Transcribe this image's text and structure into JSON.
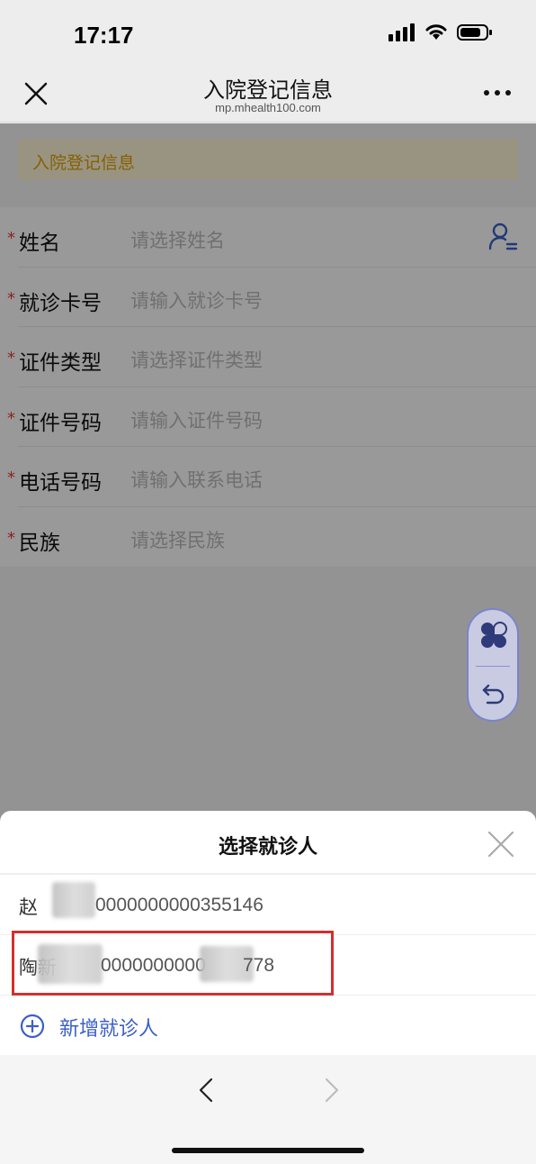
{
  "status_bar": {
    "time": "17:17"
  },
  "nav": {
    "title": "入院登记信息",
    "subtitle": "mp.mhealth100.com"
  },
  "notice": {
    "text": "入院登记信息"
  },
  "form": {
    "required_mark": "*",
    "fields": [
      {
        "label": "姓名",
        "placeholder": "请选择姓名"
      },
      {
        "label": "就诊卡号",
        "placeholder": "请输入就诊卡号"
      },
      {
        "label": "证件类型",
        "placeholder": "请选择证件类型"
      },
      {
        "label": "证件号码",
        "placeholder": "请输入证件号码"
      },
      {
        "label": "电话号码",
        "placeholder": "请输入联系电话"
      },
      {
        "label": "民族",
        "placeholder": "请选择民族"
      }
    ]
  },
  "sheet": {
    "title": "选择就诊人",
    "patients": [
      {
        "name": "赵",
        "card": "0000000000355146"
      },
      {
        "name": "陶新",
        "card_prefix": "0000000000",
        "card_suffix": "778"
      }
    ],
    "add_label": "新增就诊人"
  },
  "colors": {
    "accent": "#3a5fc7",
    "required": "#e53935",
    "notice_text": "#e0a100",
    "highlight": "#d32f2f"
  },
  "icons": [
    "close-icon",
    "more-icon",
    "person-list-icon",
    "clover-icon",
    "undo-icon",
    "add-circle-icon",
    "chevron-left-icon",
    "chevron-right-icon"
  ]
}
